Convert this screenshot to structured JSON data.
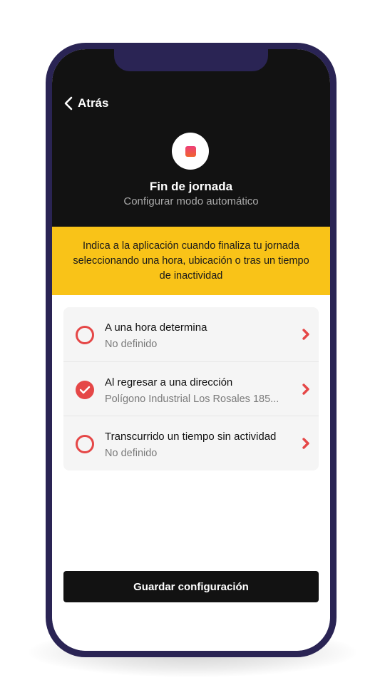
{
  "header": {
    "back_label": "Atrás",
    "title": "Fin de jornada",
    "subtitle": "Configurar modo automático",
    "stop_icon": "stop-square-icon"
  },
  "banner": {
    "text": "Indica a la aplicación cuando finaliza tu jornada seleccionando una hora, ubicación o tras un tiempo de inactividad"
  },
  "options": [
    {
      "title": "A una hora determina",
      "detail": "No definido",
      "selected": false
    },
    {
      "title": "Al regresar a una dirección",
      "detail": "Polígono Industrial Los Rosales 185...",
      "selected": true
    },
    {
      "title": "Transcurrido un tiempo sin actividad",
      "detail": "No definido",
      "selected": false
    }
  ],
  "footer": {
    "save_label": "Guardar configuración"
  },
  "colors": {
    "accent": "#e54747",
    "banner": "#f9c318",
    "header": "#121212",
    "frame": "#2a2454"
  }
}
